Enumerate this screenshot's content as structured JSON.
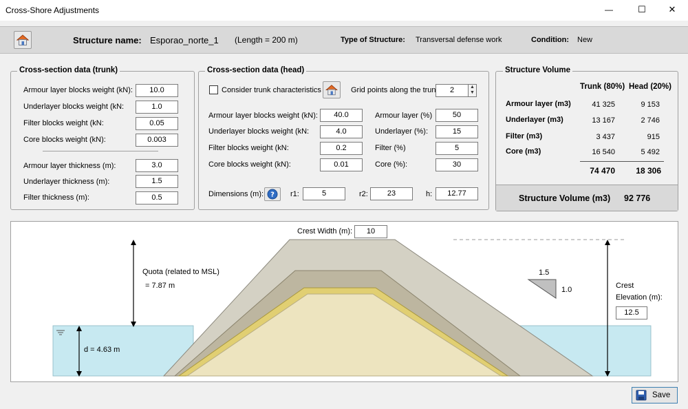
{
  "window": {
    "title": "Cross-Shore Adjustments",
    "minimize_glyph": "—",
    "maximize_glyph": "☐",
    "close_glyph": "✕"
  },
  "header": {
    "home_icon": "home-icon",
    "structure_name_label": "Structure name:",
    "structure_name": "Esporao_norte_1",
    "length": "(Length = 200 m)",
    "type_label": "Type of Structure:",
    "type_value": "Transversal defense work",
    "condition_label": "Condition:",
    "condition_value": "New"
  },
  "trunk": {
    "title": "Cross-section data (trunk)",
    "fields": [
      {
        "label": "Armour layer blocks weight (kN):",
        "value": "10.0"
      },
      {
        "label": "Underlayer blocks weight (kN:",
        "value": "1.0"
      },
      {
        "label": "Filter blocks weight (kN:",
        "value": "0.05"
      },
      {
        "label": "Core blocks weight (kN):",
        "value": "0.003"
      },
      {
        "label": "Armour layer thickness (m):",
        "value": "3.0"
      },
      {
        "label": "Underlayer thickness (m):",
        "value": "1.5"
      },
      {
        "label": "Filter thickness (m):",
        "value": "0.5"
      }
    ]
  },
  "head": {
    "title": "Cross-section data (head)",
    "consider_label": "Consider trunk characteristics",
    "consider_checked": false,
    "grid_label": "Grid points along the trunk",
    "grid_value": "2",
    "weights": [
      {
        "label": "Armour layer blocks weight (kN):",
        "value": "40.0"
      },
      {
        "label": "Underlayer blocks weight (kN:",
        "value": "4.0"
      },
      {
        "label": "Filter blocks weight (kN:",
        "value": "0.2"
      },
      {
        "label": "Core blocks weight (kN):",
        "value": "0.01"
      }
    ],
    "percents": [
      {
        "label": "Armour layer (%)",
        "value": "50"
      },
      {
        "label": "Underlayer (%):",
        "value": "15"
      },
      {
        "label": "Filter (%)",
        "value": "5"
      },
      {
        "label": "Core (%):",
        "value": "30"
      }
    ],
    "dimensions_label": "Dimensions (m):",
    "r1_label": "r1:",
    "r1": "5",
    "r2_label": "r2:",
    "r2": "23",
    "h_label": "h:",
    "h": "12.77"
  },
  "volume": {
    "title": "Structure Volume",
    "col_trunk": "Trunk (80%)",
    "col_head": "Head (20%)",
    "rows": [
      {
        "label": "Armour layer (m3)",
        "trunk": "41 325",
        "head": "9 153"
      },
      {
        "label": "Underlayer (m3)",
        "trunk": "13 167",
        "head": "2 746"
      },
      {
        "label": "Filter (m3)",
        "trunk": "3 437",
        "head": "915"
      },
      {
        "label": "Core (m3)",
        "trunk": "16 540",
        "head": "5 492"
      }
    ],
    "total_trunk": "74 470",
    "total_head": "18 306",
    "total_label": "Structure Volume (m3)",
    "total_value": "92 776"
  },
  "diagram": {
    "crest_width_label": "Crest Width (m):",
    "crest_width": "10",
    "quota_label": "Quota (related to MSL)",
    "quota_value": "= 7.87 m",
    "depth": "d = 4.63 m",
    "slope_h": "1.5",
    "slope_v": "1.0",
    "crest_elev_label_1": "Crest",
    "crest_elev_label_2": "Elevation (m):",
    "crest_elev": "12.5",
    "colors": {
      "water": "#c7e9f1",
      "armour": "#d4d1c4",
      "under": "#bdb6a0",
      "filter": "#e1cf72",
      "core": "#ede4bf"
    }
  },
  "footer": {
    "save_label": "Save",
    "save_icon": "floppy-disk-icon"
  }
}
